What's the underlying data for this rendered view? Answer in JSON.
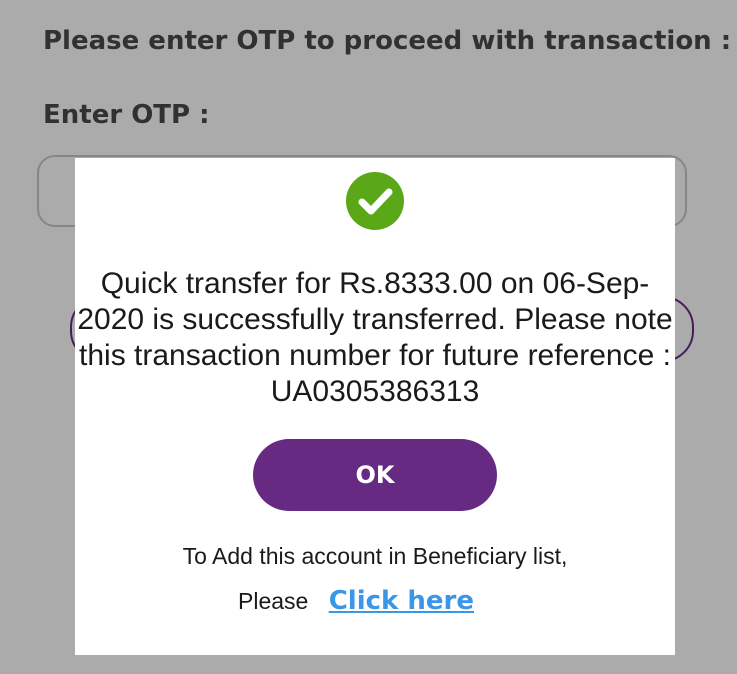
{
  "page": {
    "prompt": "Please enter OTP to proceed with transaction :",
    "otp_label": "Enter OTP :",
    "otp_value": ""
  },
  "dialog": {
    "icon": "check-circle-icon",
    "message": "Quick transfer for Rs.8333.00 on 06-Sep-2020 is successfully transferred. Please note this transaction number for future reference : UA0305386313",
    "ok_label": "OK",
    "beneficiary_text": "To Add this account in Beneficiary list,",
    "please_text": "Please",
    "link_label": "Click here"
  },
  "colors": {
    "accent": "#662a82",
    "success": "#5aa817",
    "link": "#3a96e6"
  }
}
